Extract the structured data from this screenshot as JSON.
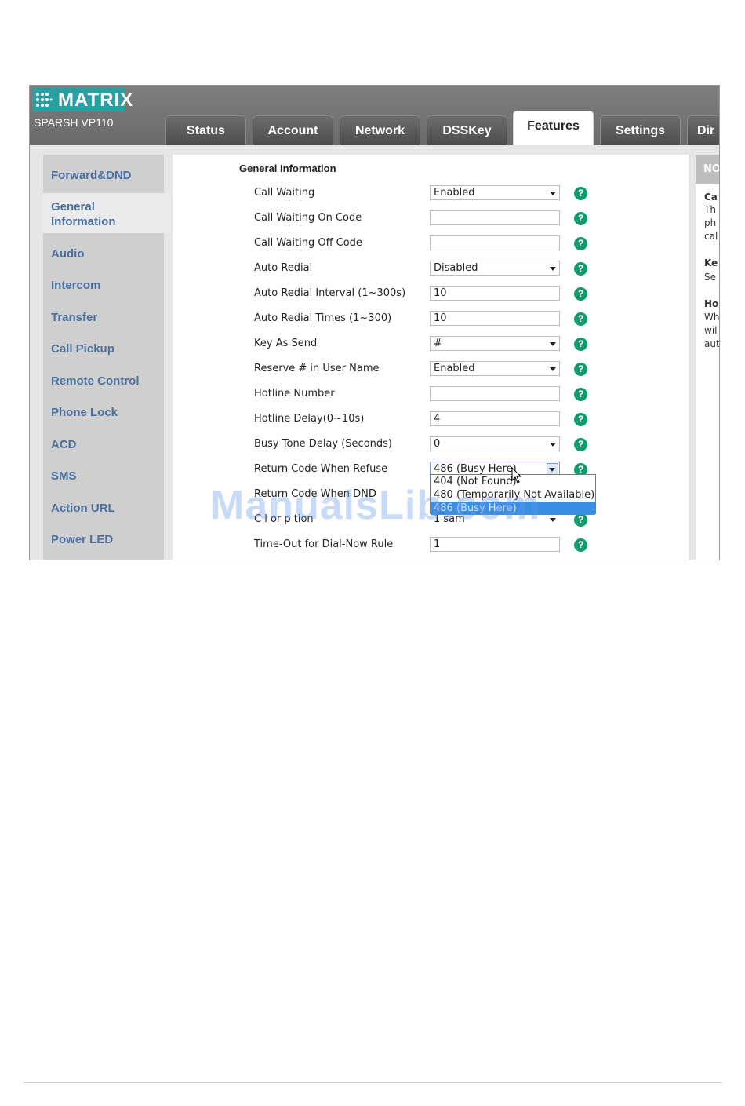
{
  "brand": {
    "logo_text": "MATRIX",
    "model": "SPARSH VP110"
  },
  "tabs": [
    {
      "label": "Status"
    },
    {
      "label": "Account"
    },
    {
      "label": "Network"
    },
    {
      "label": "DSSKey"
    },
    {
      "label": "Features",
      "active": true
    },
    {
      "label": "Settings"
    },
    {
      "label": "Dir"
    }
  ],
  "sidebar": {
    "items": [
      {
        "label": "Forward&DND"
      },
      {
        "label": "General",
        "label2": "Information",
        "active": true
      },
      {
        "label": "Audio"
      },
      {
        "label": "Intercom"
      },
      {
        "label": "Transfer"
      },
      {
        "label": "Call Pickup"
      },
      {
        "label": "Remote Control"
      },
      {
        "label": "Phone Lock"
      },
      {
        "label": "ACD"
      },
      {
        "label": "SMS"
      },
      {
        "label": "Action URL"
      },
      {
        "label": "Power LED"
      }
    ]
  },
  "main": {
    "section_title": "General Information",
    "rows": [
      {
        "label": "Call Waiting",
        "type": "select",
        "value": "Enabled"
      },
      {
        "label": "Call Waiting On Code",
        "type": "text",
        "value": ""
      },
      {
        "label": "Call Waiting Off Code",
        "type": "text",
        "value": ""
      },
      {
        "label": "Auto Redial",
        "type": "select",
        "value": "Disabled"
      },
      {
        "label": "Auto Redial Interval (1~300s)",
        "type": "text",
        "value": "10"
      },
      {
        "label": "Auto Redial Times (1~300)",
        "type": "text",
        "value": "10"
      },
      {
        "label": "Key As Send",
        "type": "select",
        "value": "#"
      },
      {
        "label": "Reserve # in User Name",
        "type": "select",
        "value": "Enabled"
      },
      {
        "label": "Hotline Number",
        "type": "text",
        "value": ""
      },
      {
        "label": "Hotline Delay(0~10s)",
        "type": "text",
        "value": "4"
      },
      {
        "label": "Busy Tone Delay (Seconds)",
        "type": "select",
        "value": "0"
      },
      {
        "label": "Return Code When Refuse",
        "type": "select-open",
        "value": "486 (Busy Here)"
      },
      {
        "label": "Return Code When DND",
        "type": "hidden",
        "value": ""
      },
      {
        "label": "C l  or  p tion",
        "type": "hidden",
        "value": "1 sam"
      },
      {
        "label": "Time-Out for Dial-Now Rule",
        "type": "text",
        "value": "1"
      }
    ],
    "dropdown_options": [
      "404 (Not Found)",
      "480 (Temporarily Not Available)",
      "486 (Busy Here)"
    ],
    "dropdown_selected_index": 2,
    "help_glyph": "?"
  },
  "right_panel": {
    "header": "NO",
    "lines": [
      "Ca",
      "Th",
      "ph",
      "cal",
      "Ke",
      "Se",
      "Ho",
      "Wh",
      "wil",
      "aut"
    ]
  },
  "watermark": "ManualsLib.com",
  "colors": {
    "accent_teal": "#2a9ea0",
    "help_green": "#139a6a",
    "sidebar_link": "#4a6fa0",
    "selection_blue": "#3b8ee6"
  }
}
